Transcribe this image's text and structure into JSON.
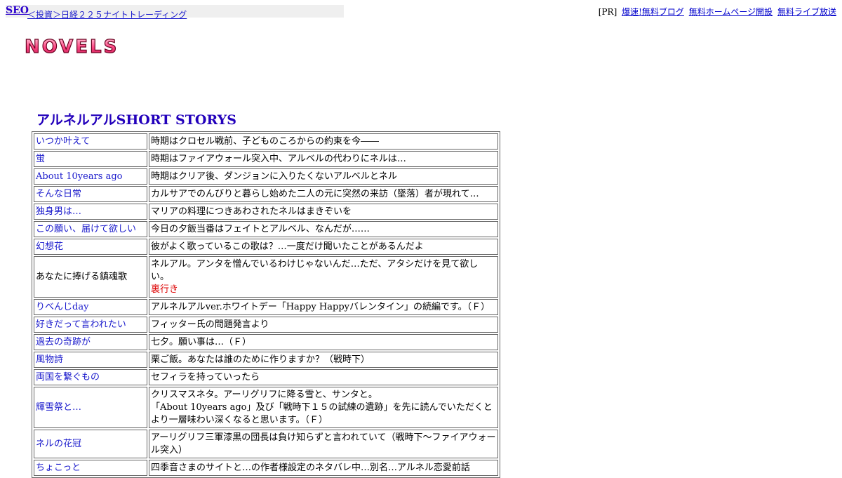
{
  "topbar": {
    "seo": "SEO",
    "breadcrumb": "＜投資＞日経２２５ナイトトレーディング",
    "pr_prefix": "[PR]",
    "pr_links": [
      "爆速!無料ブログ",
      "無料ホームページ開設",
      "無料ライブ放送"
    ]
  },
  "logo": {
    "text": "NOVELS"
  },
  "heading": "アルネルアルSHORT STORYS",
  "rows": [
    {
      "title": "いつか叶えて",
      "desc": "時期はクロセル戦前、子どものころからの約束を今――"
    },
    {
      "title": "蛍",
      "desc": "時期はファイアウォール突入中、アルベルの代わりにネルは…"
    },
    {
      "title": "About 10years ago",
      "desc": "時期はクリア後、ダンジョンに入りたくないアルベルとネル"
    },
    {
      "title": "そんな日常",
      "desc": "カルサアでのんびりと暮らし始めた二人の元に突然の来訪（墜落）者が現れて…"
    },
    {
      "title": "独身男は…",
      "desc": "マリアの料理につきあわされたネルはまきぞいを"
    },
    {
      "title": "この願い、届けて欲しい",
      "desc": "今日の夕飯当番はフェイトとアルベル、なんだが……"
    },
    {
      "title": "幻想花",
      "desc": "彼がよく歌っているこの歌は？…一度だけ聞いたことがあるんだよ"
    },
    {
      "title": "あなたに捧げる鎮魂歌",
      "desc": "ネルアル。アンタを憎んでいるわけじゃないんだ…ただ、アタシだけを見て欲しい。",
      "note": "裏行き"
    },
    {
      "title": "りべんじday",
      "desc": "アルネルアルver.ホワイトデー「Happy Happyバレンタイン」の続編です。（Ｆ）"
    },
    {
      "title": "好きだって言われたい",
      "desc": "フィッター氏の問題発言より"
    },
    {
      "title": "過去の奇跡が",
      "desc": "七夕。願い事は…（Ｆ）"
    },
    {
      "title": "風物詩",
      "desc": "栗ご飯。あなたは誰のために作りますか？（戦時下）"
    },
    {
      "title": "両国を繋ぐもの",
      "desc": "セフィラを持っていったら"
    },
    {
      "title": "輝雪祭と…",
      "desc": "クリスマスネタ。アーリグリフに降る雪と、サンタと。",
      "desc2": "「About 10years ago」及び「戦時下１５の試練の遺跡」を先に読んでいただくとより一層味わい深くなると思います。（Ｆ）"
    },
    {
      "title": "ネルの花冠",
      "desc": "アーリグリフ三軍漆黒の団長は負け知らずと言われていて（戦時下～ファイアウォール突入）"
    },
    {
      "title": "ちょこっと",
      "desc": "四季音さまのサイトと…の作者様設定のネタバレ中…別名…アルネル恋愛前話"
    }
  ]
}
